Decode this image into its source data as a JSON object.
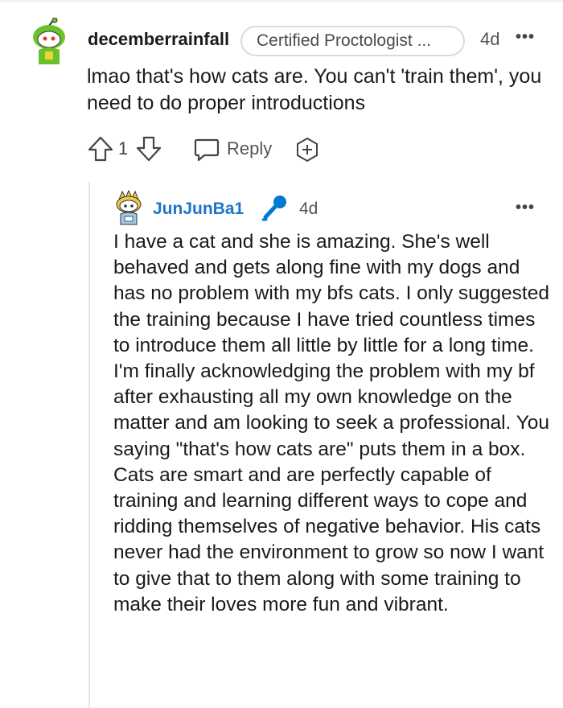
{
  "parent_comment": {
    "username": "decemberrainfall",
    "flair": "Certified Proctologist ...",
    "time": "4d",
    "more_label": "•••",
    "body": "lmao that's how cats are. You can't 'train them', you need to do proper introductions",
    "vote_count": "1",
    "reply_label": "Reply",
    "icons": [
      "avatar",
      "upvote-icon",
      "downvote-icon",
      "reply-icon",
      "award-icon",
      "more-options-icon"
    ]
  },
  "reply_comment": {
    "username": "JunJunBa1",
    "time": "4d",
    "more_label": "•••",
    "body": "I have a cat and she is amazing. She's well behaved and gets along fine with my dogs and has no problem with my bfs cats. I only suggested the training because I have tried countless times to introduce them all little by little for a long time. I'm finally acknowledging the problem with my bf after exhausting all my own knowledge on the matter and am looking to seek a professional. You saying \"that's how cats are\" puts them in a box. Cats are smart and are perfectly capable of training and learning different ways to cope and ridding themselves of negative behavior. His cats never had the environment to grow so now I want to give that to them along with some training to make their loves more fun and vibrant.",
    "icons": [
      "avatar",
      "microphone-icon",
      "more-options-icon"
    ]
  },
  "colors": {
    "username_link": "#1e74c8",
    "text": "#1a1a1b",
    "muted": "#555555",
    "mic_blue": "#0079d3",
    "avatar_green": "#6ac12a"
  }
}
